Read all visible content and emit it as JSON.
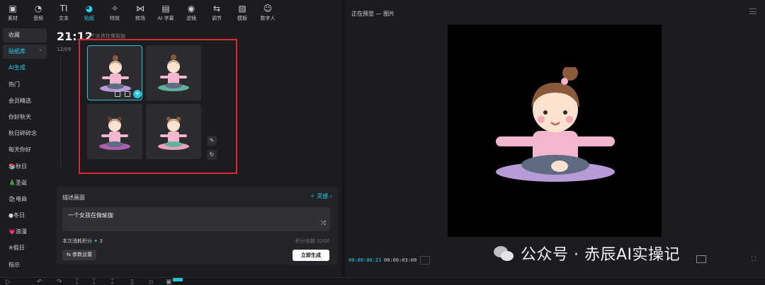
{
  "toolbar": {
    "tabs": [
      {
        "label": "素材",
        "icon": "media-icon",
        "glyph": "▣"
      },
      {
        "label": "音频",
        "icon": "audio-icon",
        "glyph": "◔"
      },
      {
        "label": "文本",
        "icon": "text-icon",
        "glyph": "TI"
      },
      {
        "label": "贴纸",
        "icon": "sticker-icon",
        "glyph": "◕",
        "active": true
      },
      {
        "label": "特效",
        "icon": "effects-icon",
        "glyph": "✧"
      },
      {
        "label": "转场",
        "icon": "transition-icon",
        "glyph": "⋈"
      },
      {
        "label": "AI 字幕",
        "icon": "ai-caption-icon",
        "glyph": "▤"
      },
      {
        "label": "滤镜",
        "icon": "filter-icon",
        "glyph": "◉"
      },
      {
        "label": "调节",
        "icon": "adjust-icon",
        "glyph": "⇆"
      },
      {
        "label": "模板",
        "icon": "template-icon",
        "glyph": "▨"
      },
      {
        "label": "数字人",
        "icon": "digital-human-icon",
        "glyph": "☺"
      }
    ]
  },
  "sidebar": {
    "items": [
      {
        "label": "收藏"
      },
      {
        "label": "贴纸库",
        "caret": "⌃"
      },
      {
        "label": "AI生成"
      },
      {
        "label": "热门"
      },
      {
        "label": "会员精选"
      },
      {
        "label": "你好秋天"
      },
      {
        "label": "秋日碎碎念"
      },
      {
        "label": "每天你好"
      },
      {
        "label": "📚秋日"
      },
      {
        "label": "🎄圣诞"
      },
      {
        "label": "🛍电商"
      },
      {
        "label": "●冬日"
      },
      {
        "label": "💗浪漫"
      },
      {
        "label": "※假日"
      },
      {
        "label": "指示"
      }
    ]
  },
  "generation": {
    "time": "21:12",
    "prompt_preview": "一个女孩在做瑜伽",
    "date": "12/09"
  },
  "describe": {
    "title": "描述画面",
    "inspiration": "灵感",
    "prompt": "一个女孩在做瑜伽",
    "cost_label": "本次消耗积分",
    "cost_value": "3",
    "balance": "积分余额 3200",
    "params_button": "参数设置",
    "generate_button": "立即生成"
  },
  "preview": {
    "title": "正在预览 — 图片",
    "current_time": "00:00:00:21",
    "duration": "00:00:03:00"
  },
  "watermark": {
    "text": "公众号 · 赤辰AI实操记"
  },
  "colors": {
    "accent": "#22d3ee",
    "highlight_box": "#e0262c"
  }
}
